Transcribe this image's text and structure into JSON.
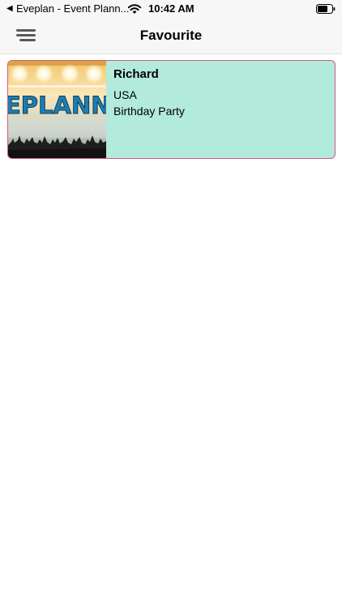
{
  "status_bar": {
    "back_glyph": "◀",
    "app_name": "Eveplan - Event Plann...",
    "time": "10:42 AM"
  },
  "nav": {
    "title": "Favourite",
    "menu_icon": "hamburger-menu-icon"
  },
  "favourites": [
    {
      "name": "Richard",
      "country": "USA",
      "event": "Birthday Party",
      "thumbnail_text": "EPLANN"
    }
  ],
  "colors": {
    "card_background": "#b2eadb",
    "card_border": "#d55b78",
    "bar_background": "#f7f7f7",
    "thumbnail_text": "#1d7fae"
  }
}
